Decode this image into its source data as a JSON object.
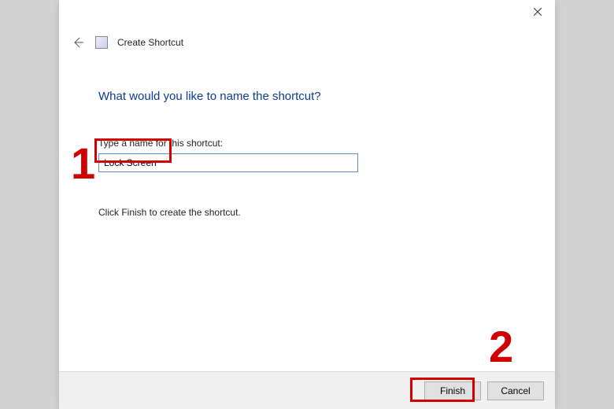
{
  "window": {
    "wizard_title": "Create Shortcut"
  },
  "content": {
    "heading": "What would you like to name the shortcut?",
    "field_label": "Type a name for this shortcut:",
    "input_value": "Lock Screen",
    "instruction": "Click Finish to create the shortcut."
  },
  "buttons": {
    "finish": "Finish",
    "cancel": "Cancel"
  },
  "annotations": {
    "marker1": "1",
    "marker2": "2"
  }
}
